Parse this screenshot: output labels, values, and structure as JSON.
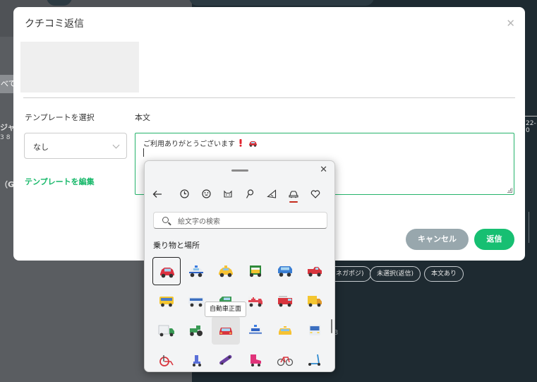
{
  "modal": {
    "title": "クチコミ返信",
    "close_icon": "close-icon",
    "template_label": "テンプレートを選択",
    "template_value": "なし",
    "body_label": "本文",
    "body_text": "ご利用ありがとうございます",
    "edit_template_link": "テンプレートを編集",
    "cancel_label": "キャンセル",
    "reply_label": "返信"
  },
  "emoji_panel": {
    "search_placeholder": "絵文字の検索",
    "section_title": "乗り物と場所",
    "tooltip": "自動車正面",
    "tabs": [
      "back-arrow-icon",
      "clock-icon",
      "smiley-icon",
      "cat-face-icon",
      "lollipop-icon",
      "pizza-slice-icon",
      "car-icon",
      "heart-icon"
    ],
    "active_tab": "car-icon",
    "emoji_rows": [
      [
        "automobile",
        "police-car",
        "taxi",
        "auto-rickshaw",
        "suv",
        "pickup-truck"
      ],
      [
        "trolleybus",
        "bus",
        "minibus",
        "ambulance",
        "fire-engine",
        "delivery-truck"
      ],
      [
        "articulated-lorry",
        "tractor",
        "oncoming-automobile",
        "oncoming-police-car",
        "oncoming-taxi",
        "oncoming-bus"
      ],
      [
        "manual-wheelchair",
        "motorized-wheelchair",
        "skateboard",
        "roller-skate",
        "bicycle",
        "kick-scooter"
      ]
    ]
  },
  "background": {
    "tab_fragment": "べて",
    "frag1": "ジャ",
    "frag2": "38",
    "frag3": "（GE",
    "date_fragment": "22-0",
    "chips": [
      "ネガポジ)",
      "未選択(返信)",
      "本文あり"
    ],
    "row_num": "3"
  },
  "colors": {
    "accent_green": "#17bf72",
    "cancel_gray": "#98a7ad",
    "link_green": "#17b86a",
    "active_tab_red": "#c42b1c"
  }
}
